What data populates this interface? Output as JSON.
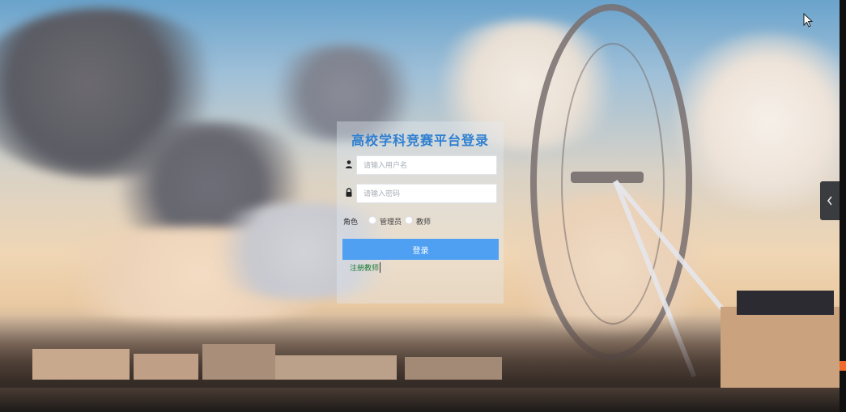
{
  "login": {
    "title": "高校学科竞赛平台登录",
    "username": {
      "placeholder": "请输入用户名",
      "icon": "user-icon"
    },
    "password": {
      "placeholder": "请输入密码",
      "icon": "lock-icon"
    },
    "role": {
      "label": "角色",
      "options": [
        "管理员",
        "教师"
      ]
    },
    "submit_label": "登录",
    "register_label": "注册教师"
  },
  "side_panel": {
    "toggle_icon": "chevron-left-icon"
  },
  "theme": {
    "accent": "#4fa0f3",
    "title_color": "#2f7fd1",
    "link_color": "#1f7a3a"
  }
}
